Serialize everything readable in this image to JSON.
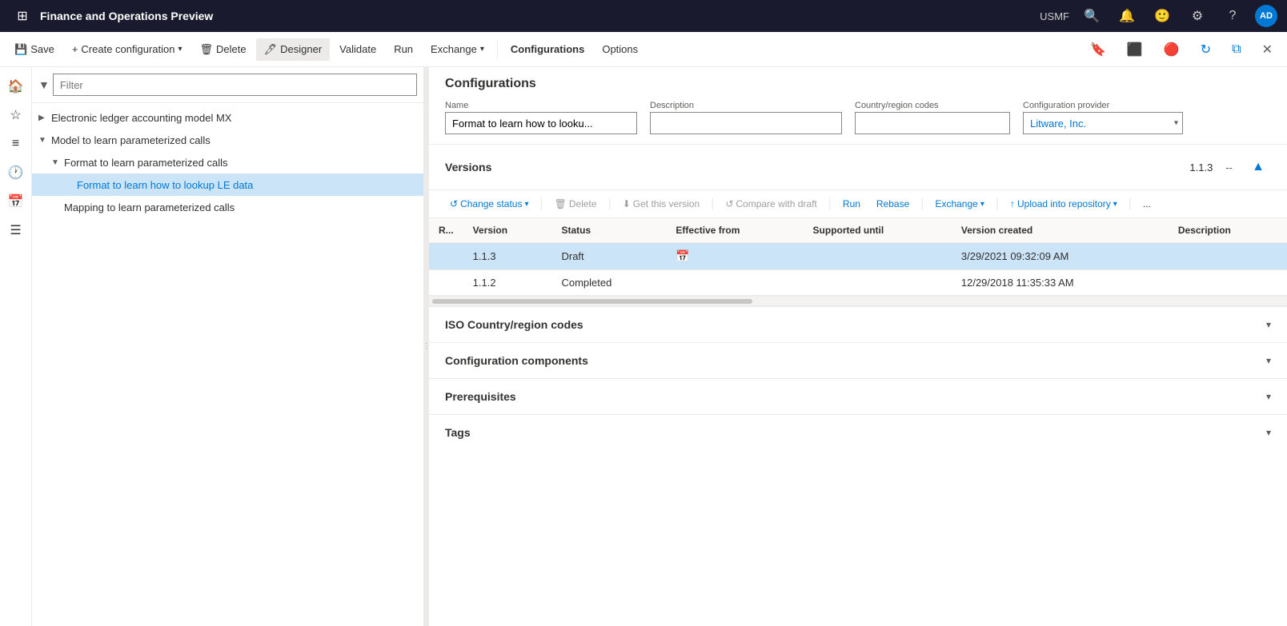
{
  "titlebar": {
    "apps_icon": "⊞",
    "title": "Finance and Operations Preview",
    "user": "USMF",
    "user_avatar": "AD",
    "search_icon": "🔍",
    "bell_icon": "🔔",
    "smile_icon": "🙂",
    "gear_icon": "⚙",
    "help_icon": "?",
    "close_icon": "✕",
    "restore_icon": "⧉",
    "minimize_icon": "—"
  },
  "commandbar": {
    "save_label": "Save",
    "create_config_label": "Create configuration",
    "delete_label": "Delete",
    "designer_label": "Designer",
    "validate_label": "Validate",
    "run_label": "Run",
    "exchange_label": "Exchange",
    "configurations_label": "Configurations",
    "options_label": "Options"
  },
  "sidebar": {
    "filter_placeholder": "Filter",
    "items": [
      {
        "id": "item-1",
        "label": "Electronic ledger accounting model MX",
        "level": 0,
        "expanded": false,
        "type": "collapsed"
      },
      {
        "id": "item-2",
        "label": "Model to learn parameterized calls",
        "level": 0,
        "expanded": true,
        "type": "expanded"
      },
      {
        "id": "item-3",
        "label": "Format to learn parameterized calls",
        "level": 1,
        "expanded": true,
        "type": "expanded"
      },
      {
        "id": "item-4",
        "label": "Format to learn how to lookup LE data",
        "level": 2,
        "expanded": false,
        "type": "leaf",
        "selected": true
      },
      {
        "id": "item-5",
        "label": "Mapping to learn parameterized calls",
        "level": 1,
        "expanded": false,
        "type": "leaf"
      }
    ]
  },
  "content": {
    "page_title": "Configurations",
    "form": {
      "name_label": "Name",
      "name_value": "Format to learn how to looku...",
      "description_label": "Description",
      "description_value": "",
      "country_region_label": "Country/region codes",
      "country_region_value": "",
      "config_provider_label": "Configuration provider",
      "config_provider_value": "Litware, Inc."
    },
    "versions": {
      "section_title": "Versions",
      "version_number": "1.1.3",
      "separator": "--",
      "toolbar": {
        "change_status_label": "Change status",
        "delete_label": "Delete",
        "get_version_label": "Get this version",
        "compare_draft_label": "Compare with draft",
        "run_label": "Run",
        "rebase_label": "Rebase",
        "exchange_label": "Exchange",
        "upload_repo_label": "Upload into repository",
        "more_label": "..."
      },
      "table": {
        "columns": [
          "R...",
          "Version",
          "Status",
          "Effective from",
          "Supported until",
          "Version created",
          "Description"
        ],
        "rows": [
          {
            "r": "",
            "version": "1.1.3",
            "status": "Draft",
            "effective_from": "",
            "supported_until": "",
            "version_created": "3/29/2021 09:32:09 AM",
            "description": "",
            "selected": true
          },
          {
            "r": "",
            "version": "1.1.2",
            "status": "Completed",
            "effective_from": "",
            "supported_until": "",
            "version_created": "12/29/2018 11:35:33 AM",
            "description": "",
            "selected": false
          }
        ]
      }
    },
    "collapsibles": [
      {
        "id": "iso",
        "title": "ISO Country/region codes",
        "expanded": false
      },
      {
        "id": "components",
        "title": "Configuration components",
        "expanded": false
      },
      {
        "id": "prerequisites",
        "title": "Prerequisites",
        "expanded": false
      },
      {
        "id": "tags",
        "title": "Tags",
        "expanded": false
      }
    ]
  }
}
